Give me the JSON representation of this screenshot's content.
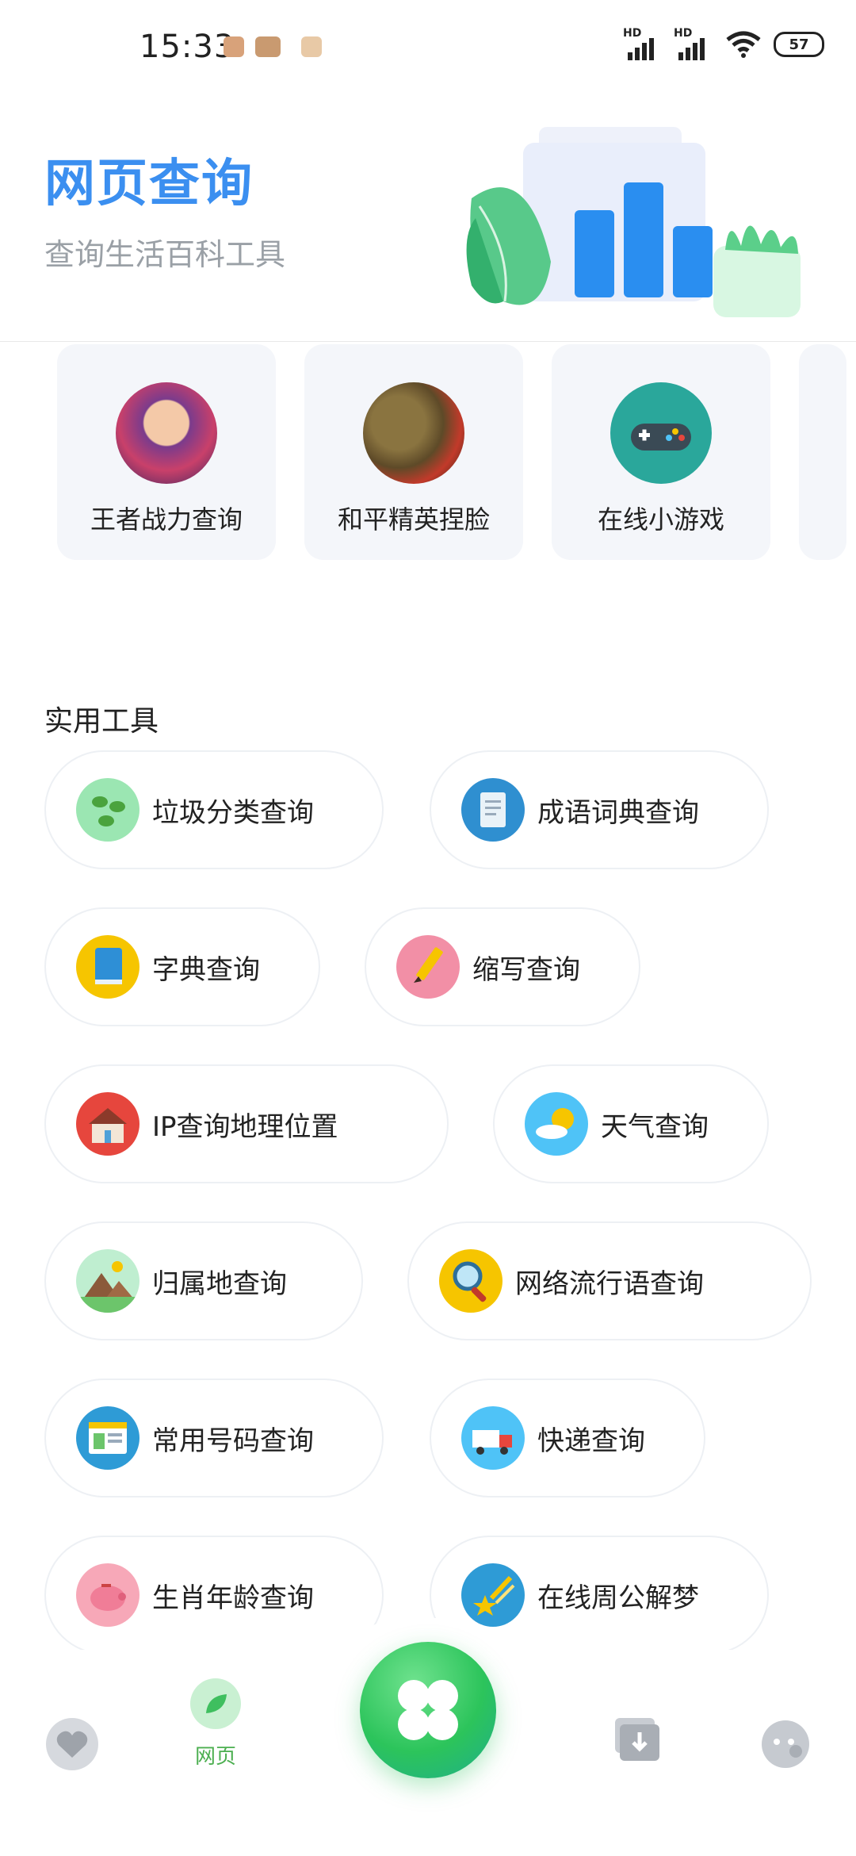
{
  "status_bar": {
    "time": "15:33",
    "signal1_label": "HD",
    "signal2_label": "HD",
    "battery": "57"
  },
  "header": {
    "title": "网页查询",
    "subtitle": "查询生活百科工具"
  },
  "game_cards": [
    {
      "label": "王者战力查询",
      "icon": "game-hero-avatar-icon"
    },
    {
      "label": "和平精英捏脸",
      "icon": "game-soldier-avatar-icon"
    },
    {
      "label": "在线小游戏",
      "icon": "gamepad-icon"
    }
  ],
  "tools": {
    "title": "实用工具",
    "items": [
      {
        "label": "垃圾分类查询",
        "icon": "leaves-icon",
        "color": "#8ee0a4"
      },
      {
        "label": "成语词典查询",
        "icon": "document-icon",
        "color": "#2f8fd0"
      },
      {
        "label": "字典查询",
        "icon": "book-icon",
        "color": "#f6c500"
      },
      {
        "label": "缩写查询",
        "icon": "pencil-icon",
        "color": "#f28fa6"
      },
      {
        "label": "IP查询地理位置",
        "icon": "house-icon",
        "color": "#e6463d"
      },
      {
        "label": "天气查询",
        "icon": "weather-icon",
        "color": "#4fc3f7"
      },
      {
        "label": "归属地查询",
        "icon": "mountain-icon",
        "color": "#9be0a8"
      },
      {
        "label": "网络流行语查询",
        "icon": "magnifier-icon",
        "color": "#f6c500"
      },
      {
        "label": "常用号码查询",
        "icon": "browser-icon",
        "color": "#2e9bd6"
      },
      {
        "label": "快递查询",
        "icon": "truck-icon",
        "color": "#4fc3f7"
      },
      {
        "label": "生肖年龄查询",
        "icon": "piggy-bank-icon",
        "color": "#f28fa6"
      },
      {
        "label": "在线周公解梦",
        "icon": "shooting-star-icon",
        "color": "#2e9bd6"
      }
    ]
  },
  "bottom_nav": {
    "active_label": "网页"
  },
  "colors": {
    "accent": "#3b8ff0",
    "active_nav": "#4caf50",
    "center_button": "#2cc45b"
  }
}
